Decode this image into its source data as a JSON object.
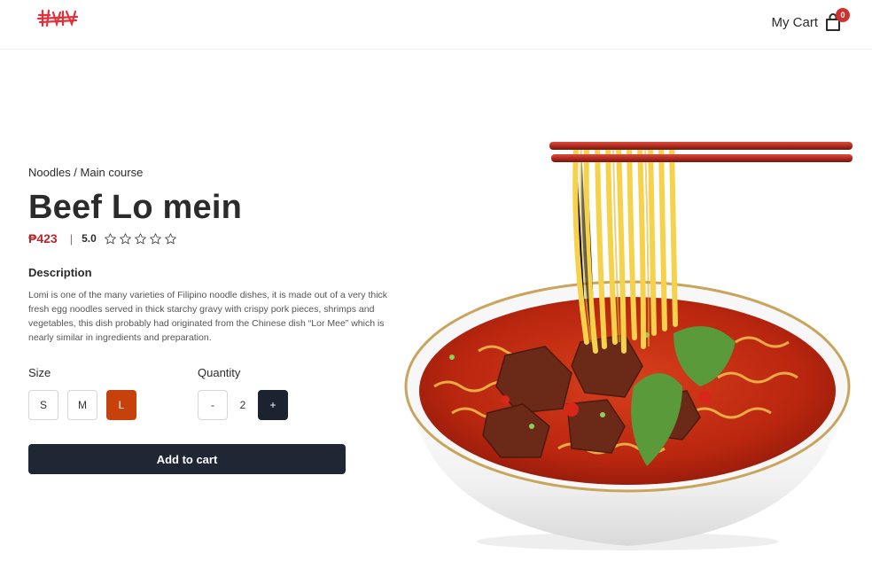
{
  "header": {
    "cart_label": "My Cart",
    "cart_count": "0",
    "logo_icon": "noodle-brand-logo",
    "cart_icon": "shopping-bag-icon"
  },
  "product": {
    "breadcrumb": "Noodles / Main course",
    "title": "Beef Lo mein",
    "price": "₱423",
    "separator": "|",
    "rating": "5.0",
    "rating_value": 5,
    "stars_filled": 0,
    "stars_total": 5,
    "description_heading": "Description",
    "description": "Lomi is one of the many varieties of Filipino noodle dishes, it is made out of a very thick fresh egg noodles served in thick starchy gravy with crispy pork pieces, shrimps and vegetables, this dish probably had originated from the Chinese dish “Lor Mee” which is nearly similar in ingredients and preparation."
  },
  "size": {
    "label": "Size",
    "options": [
      "S",
      "M",
      "L"
    ],
    "selected": "L"
  },
  "quantity": {
    "label": "Quantity",
    "decrement": "-",
    "value": "2",
    "increment": "+"
  },
  "actions": {
    "add_to_cart": "Add to cart"
  },
  "colors": {
    "accent": "#c7410d",
    "price": "#b3282d",
    "dark_button": "#1f2735",
    "badge": "#d32f2f"
  }
}
